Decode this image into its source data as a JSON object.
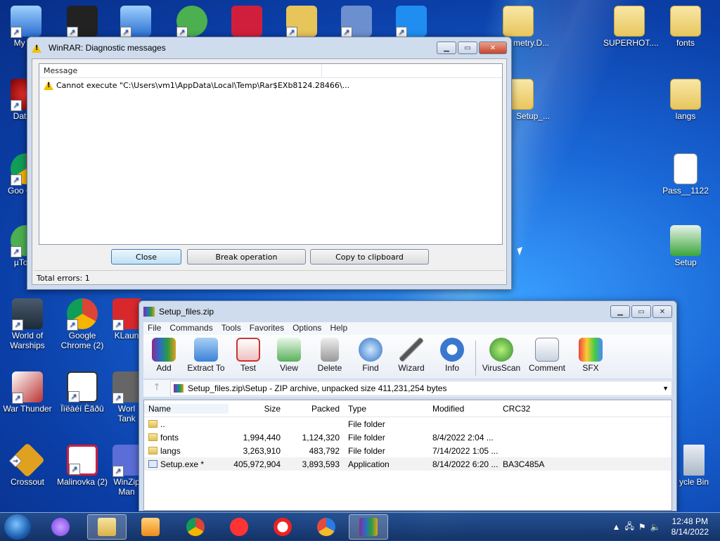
{
  "desktop": {
    "icons": [
      {
        "label": "My Co",
        "icon": "computer-icon"
      },
      {
        "label": "DataW",
        "icon": "app-icon"
      },
      {
        "label": "Goo Chro",
        "icon": "chrome-icon"
      },
      {
        "label": "µTorre",
        "icon": "utorrent-icon"
      },
      {
        "label": "World of Warships",
        "icon": "warships-icon"
      },
      {
        "label": "Google Chrome (2)",
        "icon": "chrome-icon"
      },
      {
        "label": "KLaun",
        "icon": "app-icon"
      },
      {
        "label": "War Thunder",
        "icon": "warthunder-icon"
      },
      {
        "label": "Ïïëàéí Èãðû",
        "icon": "gamepad-icon"
      },
      {
        "label": "Worl Tank",
        "icon": "tanks-icon"
      },
      {
        "label": "Crossout",
        "icon": "crossout-icon"
      },
      {
        "label": "Malinovka (2)",
        "icon": "malinovka-icon"
      },
      {
        "label": "WinZip Man",
        "icon": "winzip-icon"
      },
      {
        "label": "metry.D...",
        "icon": "folder-icon"
      },
      {
        "label": "Setup_...",
        "icon": "folder-icon"
      },
      {
        "label": "SUPERHOT....",
        "icon": "folder-icon"
      },
      {
        "label": "fonts",
        "icon": "folder-icon"
      },
      {
        "label": "langs",
        "icon": "folder-icon"
      },
      {
        "label": "Pass__1122",
        "icon": "document-icon"
      },
      {
        "label": "Setup",
        "icon": "setup-icon"
      },
      {
        "label": "ycle Bin",
        "icon": "recycle-bin-icon"
      }
    ]
  },
  "diag": {
    "title": "WinRAR: Diagnostic messages",
    "column_message": "Message",
    "row_text": "Cannot execute \"C:\\Users\\vm1\\AppData\\Local\\Temp\\Rar$EXb8124.28466\\...",
    "close_label": "Close",
    "break_label": "Break operation",
    "copy_label": "Copy to clipboard",
    "status": "Total errors: 1"
  },
  "rar": {
    "title": "Setup_files.zip",
    "menu": [
      "File",
      "Commands",
      "Tools",
      "Favorites",
      "Options",
      "Help"
    ],
    "tools": [
      "Add",
      "Extract To",
      "Test",
      "View",
      "Delete",
      "Find",
      "Wizard",
      "Info",
      "VirusScan",
      "Comment",
      "SFX"
    ],
    "path": "Setup_files.zip\\Setup - ZIP archive, unpacked size 411,231,254 bytes",
    "columns": [
      "Name",
      "Size",
      "Packed",
      "Type",
      "Modified",
      "CRC32"
    ],
    "rows": [
      {
        "name": "..",
        "size": "",
        "packed": "",
        "type": "File folder",
        "modified": "",
        "crc": ""
      },
      {
        "name": "fonts",
        "size": "1,994,440",
        "packed": "1,124,320",
        "type": "File folder",
        "modified": "8/4/2022 2:04 ...",
        "crc": ""
      },
      {
        "name": "langs",
        "size": "3,263,910",
        "packed": "483,792",
        "type": "File folder",
        "modified": "7/14/2022 1:05 ...",
        "crc": ""
      },
      {
        "name": "Setup.exe *",
        "size": "405,972,904",
        "packed": "3,893,593",
        "type": "Application",
        "modified": "8/14/2022 6:20 ...",
        "crc": "BA3C485A"
      }
    ]
  },
  "taskbar": {
    "time": "12:48 PM",
    "date": "8/14/2022"
  }
}
